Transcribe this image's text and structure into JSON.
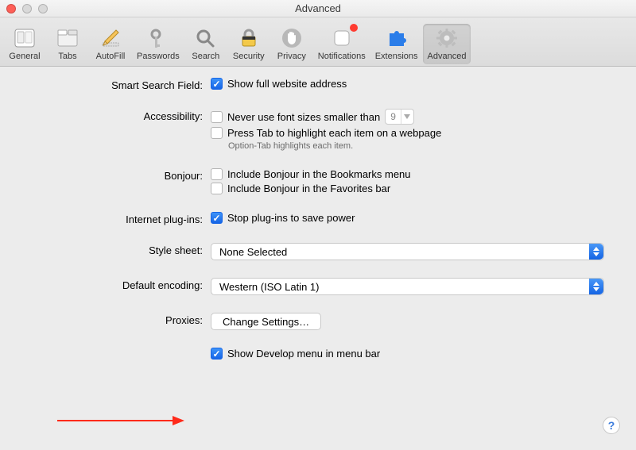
{
  "window": {
    "title": "Advanced"
  },
  "toolbar": {
    "active": "Advanced",
    "items": [
      {
        "key": "general",
        "label": "General"
      },
      {
        "key": "tabs",
        "label": "Tabs"
      },
      {
        "key": "autofill",
        "label": "AutoFill"
      },
      {
        "key": "passwords",
        "label": "Passwords"
      },
      {
        "key": "search",
        "label": "Search"
      },
      {
        "key": "security",
        "label": "Security"
      },
      {
        "key": "privacy",
        "label": "Privacy"
      },
      {
        "key": "notifications",
        "label": "Notifications",
        "badge": true
      },
      {
        "key": "extensions",
        "label": "Extensions"
      },
      {
        "key": "advanced",
        "label": "Advanced"
      }
    ]
  },
  "sections": {
    "smartSearch": {
      "label": "Smart Search Field:",
      "showFullURL": {
        "label": "Show full website address",
        "checked": true
      }
    },
    "accessibility": {
      "label": "Accessibility:",
      "minFont": {
        "label": "Never use font sizes smaller than",
        "checked": false,
        "value": "9"
      },
      "pressTab": {
        "label": "Press Tab to highlight each item on a webpage",
        "checked": false
      },
      "pressTabSub": "Option-Tab highlights each item."
    },
    "bonjour": {
      "label": "Bonjour:",
      "bookmarks": {
        "label": "Include Bonjour in the Bookmarks menu",
        "checked": false
      },
      "favorites": {
        "label": "Include Bonjour in the Favorites bar",
        "checked": false
      }
    },
    "plugins": {
      "label": "Internet plug-ins:",
      "stopToSave": {
        "label": "Stop plug-ins to save power",
        "checked": true
      }
    },
    "stylesheet": {
      "label": "Style sheet:",
      "value": "None Selected"
    },
    "encoding": {
      "label": "Default encoding:",
      "value": "Western (ISO Latin 1)"
    },
    "proxies": {
      "label": "Proxies:",
      "button": "Change Settings…"
    },
    "develop": {
      "label": "Show Develop menu in menu bar",
      "checked": true
    }
  },
  "help_glyph": "?"
}
